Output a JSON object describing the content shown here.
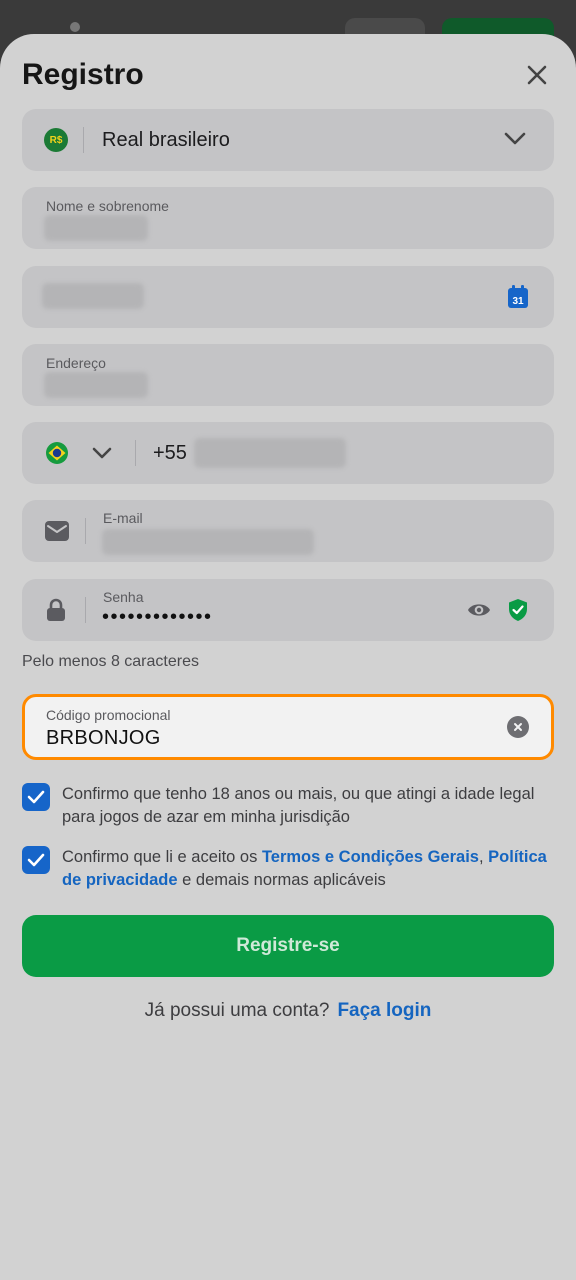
{
  "form": {
    "title": "Registro",
    "currency": {
      "symbol": "R$",
      "label": "Real brasileiro"
    },
    "name_field": {
      "label": "Nome e sobrenome"
    },
    "date_field": {
      "calendar_day": "31"
    },
    "address_field": {
      "label": "Endereço"
    },
    "phone_field": {
      "country_code": "+55"
    },
    "email_field": {
      "label": "E-mail"
    },
    "password_field": {
      "label": "Senha",
      "masked_value": "•••••••••••••"
    },
    "password_hint": "Pelo menos 8 caracteres",
    "promo_field": {
      "label": "Código promocional",
      "value": "BRBONJOG"
    },
    "consent_age": {
      "checked": true,
      "text": "Confirmo que tenho 18 anos ou mais, ou que atingi a idade legal para jogos de azar em minha jurisdição"
    },
    "consent_terms": {
      "checked": true,
      "text_before": "Confirmo que li e aceito os ",
      "terms_link": "Termos e Condições Gerais",
      "comma": ",",
      "privacy_link": "Política de privacidade",
      "text_after": " e demais normas aplicáveis"
    },
    "submit_label": "Registre-se",
    "login_prompt": "Já possui uma conta?",
    "login_link": "Faça login"
  },
  "icons": {
    "close": "close-icon",
    "currency_chevron": "chevron-down-icon",
    "calendar": "calendar-icon",
    "flag": "brazil-flag-icon",
    "mail": "mail-icon",
    "lock": "lock-icon",
    "eye": "eye-icon",
    "shield": "shield-check-icon",
    "clear": "clear-icon",
    "checkbox": "check-icon"
  },
  "colors": {
    "primary_button": "#0a9b45",
    "link": "#1565c0",
    "checkbox": "#1665c9",
    "focus_border": "#ff8a00"
  }
}
